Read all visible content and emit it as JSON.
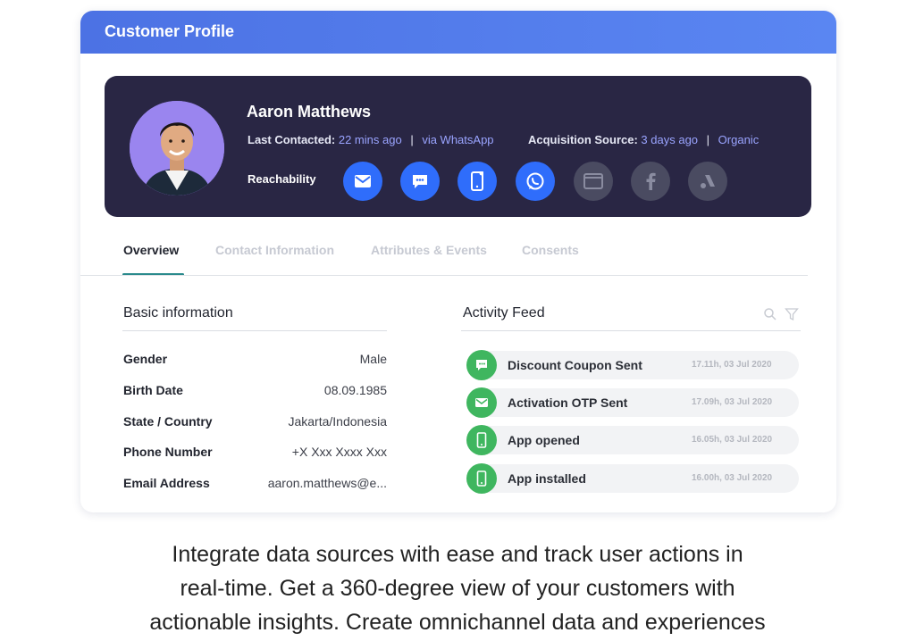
{
  "header": {
    "title": "Customer Profile"
  },
  "profile": {
    "name": "Aaron Matthews",
    "last_contacted_label": "Last Contacted:",
    "last_contacted_value": "22 mins ago",
    "last_contacted_via": "via WhatsApp",
    "acquisition_label": "Acquisition Source:",
    "acquisition_value": "3 days ago",
    "acquisition_type": "Organic",
    "separator": "|",
    "reachability_label": "Reachability",
    "channels": [
      {
        "icon": "email-icon",
        "active": true
      },
      {
        "icon": "sms-icon",
        "active": true
      },
      {
        "icon": "mobile-push-icon",
        "active": true
      },
      {
        "icon": "whatsapp-icon",
        "active": true
      },
      {
        "icon": "web-browser-icon",
        "active": false
      },
      {
        "icon": "facebook-icon",
        "active": false
      },
      {
        "icon": "google-ads-icon",
        "active": false
      }
    ]
  },
  "tabs": [
    {
      "label": "Overview",
      "active": true
    },
    {
      "label": "Contact Information",
      "active": false
    },
    {
      "label": "Attributes & Events",
      "active": false
    },
    {
      "label": "Consents",
      "active": false
    }
  ],
  "basic_info": {
    "title": "Basic information",
    "rows": [
      {
        "label": "Gender",
        "value": "Male"
      },
      {
        "label": "Birth Date",
        "value": "08.09.1985"
      },
      {
        "label": "State / Country",
        "value": "Jakarta/Indonesia"
      },
      {
        "label": "Phone Number",
        "value": "+X Xxx Xxxx Xxx"
      },
      {
        "label": "Email Address",
        "value": "aaron.matthews@e..."
      }
    ]
  },
  "activity_feed": {
    "title": "Activity Feed",
    "items": [
      {
        "text": "Discount Coupon Sent",
        "time": "17.11h, 03 Jul 2020",
        "icon": "sms-icon"
      },
      {
        "text": "Activation OTP Sent",
        "time": "17.09h, 03 Jul 2020",
        "icon": "email-icon"
      },
      {
        "text": "App opened",
        "time": "16.05h, 03 Jul 2020",
        "icon": "mobile-icon"
      },
      {
        "text": "App installed",
        "time": "16.00h, 03 Jul 2020",
        "icon": "mobile-icon"
      }
    ]
  },
  "caption": {
    "line1": "Integrate data sources with ease and track user actions in",
    "line2": "real-time. Get a 360-degree view of your customers with",
    "line3": "actionable insights. Create omnichannel data and experiences"
  },
  "colors": {
    "header": "#4c72e4",
    "hero_bg": "#292644",
    "channel_active": "#2f6dfb",
    "channel_inactive": "#4a4b61",
    "feed_icon": "#3fb65f",
    "tab_accent": "#2a8a8c"
  }
}
